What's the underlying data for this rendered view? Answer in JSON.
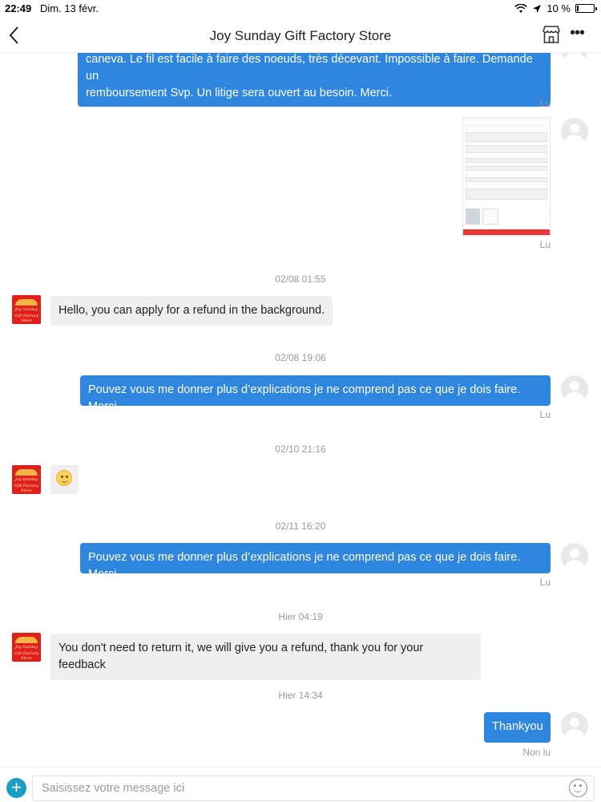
{
  "status_bar": {
    "time": "22:49",
    "date": "Dim. 13 févr.",
    "battery": "10 %",
    "battery_level": 0.1
  },
  "header": {
    "title": "Joy Sunday Gift Factory Store",
    "back_icon": "chevron-left-icon",
    "store_icon": "store-icon",
    "more_icon": "more-dots-icon",
    "more_label": "•••"
  },
  "shop_avatar": {
    "line1": "Joy Sunday",
    "line2": "Gift Factory Store"
  },
  "messages": [
    {
      "from": "me",
      "lines": [
        "caneva. Le fil est facile à faire des noeuds, très  décevant. Impossible à faire. Demande un",
        "remboursement Svp. Un litige sera ouvert au besoin. Merci."
      ],
      "status": "Lu"
    },
    {
      "from": "me",
      "type": "image",
      "status": "Lu"
    },
    {
      "timestamp": "02/08 01:55"
    },
    {
      "from": "store",
      "text": "Hello, you can apply for a refund in the background."
    },
    {
      "timestamp": "02/08 19:06"
    },
    {
      "from": "me",
      "text": "Pouvez vous me donner plus d’explications je ne comprend pas ce que je dois faire. Merci",
      "status": "Lu"
    },
    {
      "timestamp": "02/10 21:16"
    },
    {
      "from": "store",
      "type": "emoji",
      "emoji": "smile-emoji"
    },
    {
      "timestamp": "02/11 16:20"
    },
    {
      "from": "me",
      "text": "Pouvez vous me donner plus d’explications je ne comprend pas ce que je dois faire. Merci",
      "status": "Lu"
    },
    {
      "timestamp": "Hier 04:19"
    },
    {
      "from": "store",
      "text": "You don't need to return it, we will give you a refund, thank you for your feedback"
    },
    {
      "timestamp": "Hier 14:34"
    },
    {
      "from": "me",
      "text": "Thankyou",
      "status": "Non lu"
    }
  ],
  "composer": {
    "placeholder": "Saisissez votre message ici",
    "plus_label": "+",
    "add_icon": "plus-circle-icon",
    "emoji_icon": "emoji-icon"
  },
  "colors": {
    "outgoing_bubble": "#2e86de",
    "incoming_bubble": "#efefef",
    "accent_plus": "#1ba0c4",
    "shop_avatar_bg": "#e31d1a"
  }
}
